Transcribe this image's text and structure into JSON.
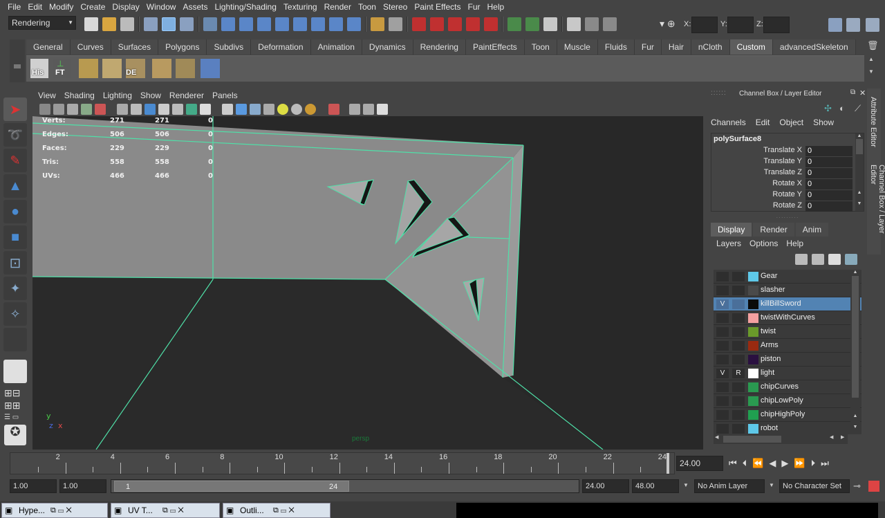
{
  "menubar": [
    "File",
    "Edit",
    "Modify",
    "Create",
    "Display",
    "Window",
    "Assets",
    "Lighting/Shading",
    "Texturing",
    "Render",
    "Toon",
    "Stereo",
    "Paint Effects",
    "Fur",
    "Help"
  ],
  "status": {
    "mode": "Rendering",
    "x_label": "X:",
    "y_label": "Y:",
    "z_label": "Z:"
  },
  "shelf": {
    "tabs": [
      "General",
      "Curves",
      "Surfaces",
      "Polygons",
      "Subdivs",
      "Deformation",
      "Animation",
      "Dynamics",
      "Rendering",
      "PaintEffects",
      "Toon",
      "Muscle",
      "Fluids",
      "Fur",
      "Hair",
      "nCloth",
      "Custom",
      "advancedSkeleton"
    ],
    "active": "Custom",
    "icon_labels": [
      "His",
      "FT",
      "DE"
    ]
  },
  "viewport": {
    "menu": [
      "View",
      "Shading",
      "Lighting",
      "Show",
      "Renderer",
      "Panels"
    ],
    "hud": [
      {
        "label": "Verts:",
        "a": "271",
        "b": "271",
        "c": "0"
      },
      {
        "label": "Edges:",
        "a": "506",
        "b": "506",
        "c": "0"
      },
      {
        "label": "Faces:",
        "a": "229",
        "b": "229",
        "c": "0"
      },
      {
        "label": "Tris:",
        "a": "558",
        "b": "558",
        "c": "0"
      },
      {
        "label": "UVs:",
        "a": "466",
        "b": "466",
        "c": "0"
      }
    ],
    "camera": "persp",
    "axis_y": "y",
    "axis_z": "z",
    "axis_x": "x"
  },
  "channelbox": {
    "title": "Channel Box / Layer Editor",
    "menu": [
      "Channels",
      "Edit",
      "Object",
      "Show"
    ],
    "object": "polySurface8",
    "attrs": [
      {
        "label": "Translate X",
        "value": "0"
      },
      {
        "label": "Translate Y",
        "value": "0"
      },
      {
        "label": "Translate Z",
        "value": "0"
      },
      {
        "label": "Rotate X",
        "value": "0"
      },
      {
        "label": "Rotate Y",
        "value": "0"
      },
      {
        "label": "Rotate Z",
        "value": "0"
      }
    ]
  },
  "sidetabs": {
    "attribute_editor": "Attribute Editor",
    "channel_box": "Channel Box / Layer Editor"
  },
  "layers": {
    "tabs": [
      "Display",
      "Render",
      "Anim"
    ],
    "active": "Display",
    "menu": [
      "Layers",
      "Options",
      "Help"
    ],
    "items": [
      {
        "name": "Gear",
        "color": "#5ec8e8",
        "v": "",
        "r": "",
        "selected": false
      },
      {
        "name": "slasher",
        "color": "#4a4a4a",
        "v": "",
        "r": "",
        "selected": false
      },
      {
        "name": "killBillSword",
        "color": "#0a0a0a",
        "v": "V",
        "r": "",
        "selected": true
      },
      {
        "name": "twistWithCurves",
        "color": "#f4a0a0",
        "v": "",
        "r": "",
        "selected": false
      },
      {
        "name": "twist",
        "color": "#6a9a2a",
        "v": "",
        "r": "",
        "selected": false
      },
      {
        "name": "Arms",
        "color": "#9a2a10",
        "v": "",
        "r": "",
        "selected": false
      },
      {
        "name": "piston",
        "color": "#2a1040",
        "v": "",
        "r": "",
        "selected": false
      },
      {
        "name": "light",
        "color": "#ffffff",
        "v": "V",
        "r": "R",
        "selected": false
      },
      {
        "name": "chipCurves",
        "color": "#2a9a50",
        "v": "",
        "r": "",
        "selected": false
      },
      {
        "name": "chipLowPoly",
        "color": "#2a9a50",
        "v": "",
        "r": "",
        "selected": false
      },
      {
        "name": "chipHighPoly",
        "color": "#20a050",
        "v": "",
        "r": "",
        "selected": false
      },
      {
        "name": "robot",
        "color": "#5ec8e8",
        "v": "",
        "r": "",
        "selected": false
      }
    ]
  },
  "timeline": {
    "ticks": [
      "2",
      "4",
      "6",
      "8",
      "10",
      "12",
      "14",
      "16",
      "18",
      "20",
      "22",
      "24"
    ],
    "current": "24.00"
  },
  "range": {
    "start_outer": "1.00",
    "start_inner": "1.00",
    "slider_start": "1",
    "slider_end": "24",
    "end_inner": "24.00",
    "end_outer": "48.00",
    "anim_layer": "No Anim Layer",
    "char_set": "No Character Set"
  },
  "taskbar": [
    "Hype...",
    "UV T...",
    "Outli..."
  ]
}
